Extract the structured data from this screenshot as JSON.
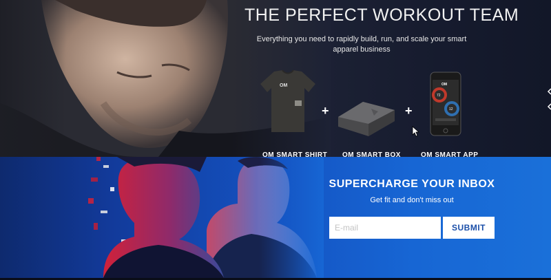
{
  "hero": {
    "title": "THE PERFECT WORKOUT TEAM",
    "subtitle": "Everything you need to rapidly build, run, and scale your smart apparel business",
    "products": [
      {
        "label": "OM SMART SHIRT",
        "logo": "OM"
      },
      {
        "label": "OM SMART BOX"
      },
      {
        "label": "OM SMART APP",
        "logo": "OM",
        "app_values": [
          "72",
          "12"
        ]
      }
    ],
    "plus_symbol": "+"
  },
  "newsletter": {
    "title": "SUPERCHARGE YOUR INBOX",
    "subtitle": "Get fit and don't miss out",
    "email_placeholder": "E-mail",
    "submit_label": "SUBMIT"
  },
  "colors": {
    "hero_bg": "#1d2235",
    "newsletter_bg": "#1766d4",
    "submit_text": "#1a4ea8",
    "app_red": "#c0392b",
    "app_blue": "#2f6fb0"
  }
}
